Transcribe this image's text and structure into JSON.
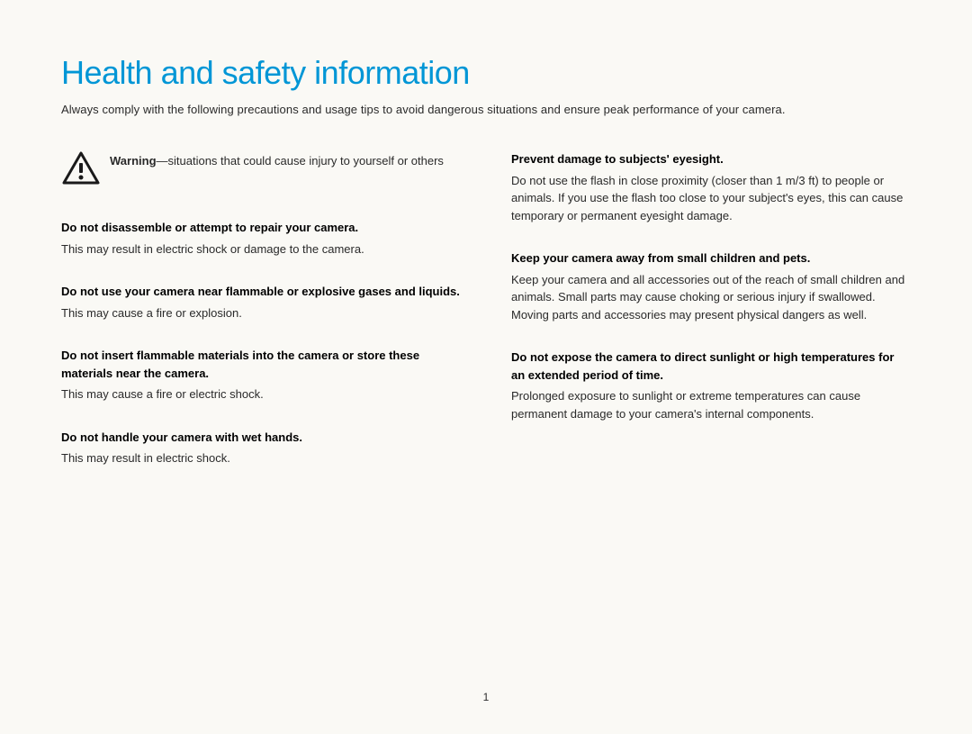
{
  "title": "Health and safety information",
  "intro": "Always comply with the following precautions and usage tips to avoid dangerous situations and ensure peak performance of your camera.",
  "warning": {
    "label": "Warning",
    "text": "—situations that could cause injury to yourself or others"
  },
  "left_column": [
    {
      "heading": "Do not disassemble or attempt to repair your camera.",
      "body": "This may result in electric shock or damage to the camera."
    },
    {
      "heading": "Do not use your camera near flammable or explosive gases and liquids.",
      "body": "This may cause a fire or explosion."
    },
    {
      "heading": "Do not insert flammable materials into the camera or store these materials near the camera.",
      "body": "This may cause a fire or electric shock."
    },
    {
      "heading": "Do not handle your camera with wet hands.",
      "body": "This may result in electric shock."
    }
  ],
  "right_column": [
    {
      "heading": "Prevent damage to subjects' eyesight.",
      "body": "Do not use the flash in close proximity (closer than 1 m/3 ft) to people or animals. If you use the flash too close to your subject's eyes, this can cause temporary or permanent eyesight damage."
    },
    {
      "heading": "Keep your camera away from small children and pets.",
      "body": "Keep your camera and all accessories out of the reach of small children and animals. Small parts may cause choking or serious injury if swallowed. Moving parts and accessories may present physical dangers as well."
    },
    {
      "heading": "Do not expose the camera to direct sunlight or high temperatures for an extended period of time.",
      "body": "Prolonged exposure to sunlight or extreme temperatures can cause permanent damage to your camera's internal components."
    }
  ],
  "page_number": "1"
}
